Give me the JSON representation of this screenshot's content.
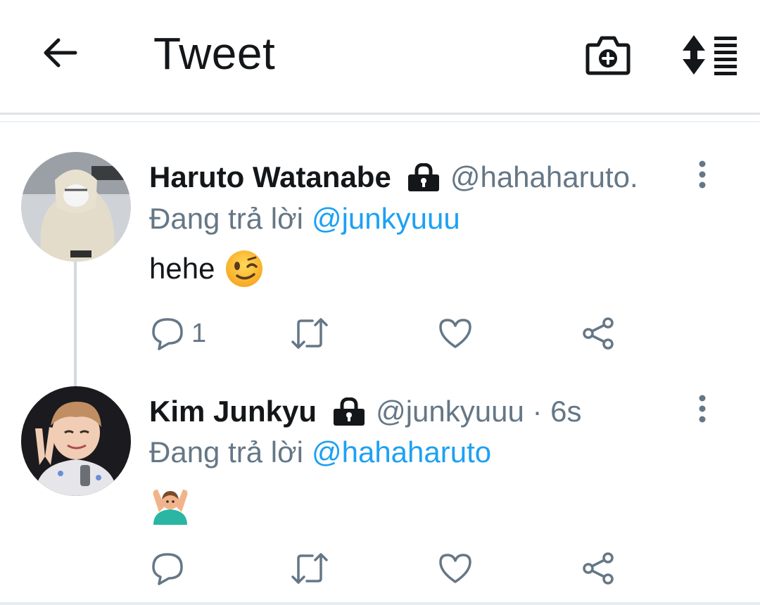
{
  "header": {
    "title": "Tweet",
    "back_icon": "arrow-left-icon",
    "camera_icon": "camera-add-icon",
    "sort_icon": "sort-icon"
  },
  "colors": {
    "text": "#14171a",
    "secondary": "#657786",
    "accent": "#1da1f2",
    "divider": "#dfe3e6"
  },
  "tweets": [
    {
      "display_name": "Haruto Watanabe",
      "protected": true,
      "handle": "@hahaharuto.",
      "time": "",
      "reply_prefix": "Đang trả lời",
      "reply_to": "@junkyuuu",
      "text": "hehe",
      "emoji": "winking-face-emoji",
      "reply_count": "1"
    },
    {
      "display_name": "Kim Junkyu",
      "protected": true,
      "handle": "@junkyuuu · 6s",
      "time": "6s",
      "reply_prefix": "Đang trả lời",
      "reply_to": "@hahaharuto",
      "text": "",
      "emoji": "person-gesturing-ok-emoji",
      "reply_count": ""
    }
  ]
}
